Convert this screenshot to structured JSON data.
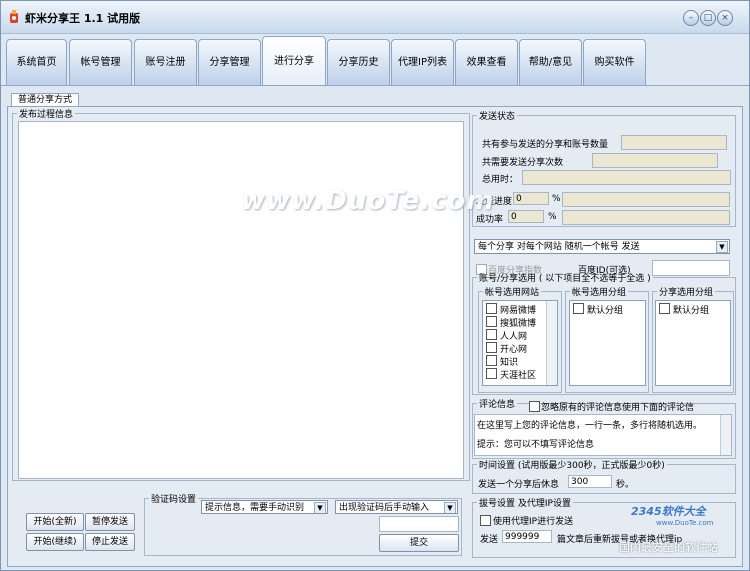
{
  "window": {
    "title": "虾米分享王 1.1 试用版"
  },
  "tabs": [
    {
      "label": "系统首页",
      "active": false
    },
    {
      "label": "帐号管理",
      "active": false
    },
    {
      "label": "账号注册",
      "active": false
    },
    {
      "label": "分享管理",
      "active": false
    },
    {
      "label": "进行分享",
      "active": true
    },
    {
      "label": "分享历史",
      "active": false
    },
    {
      "label": "代理IP列表",
      "active": false
    },
    {
      "label": "效果查看",
      "active": false
    },
    {
      "label": "帮助/意见",
      "active": false
    },
    {
      "label": "购买软件",
      "active": false
    }
  ],
  "subtab": {
    "label": "普通分享方式"
  },
  "log": {
    "legend": "发布过程信息"
  },
  "buttons": {
    "start_new": "开始(全新)",
    "pause": "暂停发送",
    "start_continue": "开始(继续)",
    "stop": "停止发送",
    "submit": "提交"
  },
  "captcha": {
    "legend": "验证码设置",
    "mode_value": "提示信息，需要手动识别",
    "when_value": "出现验证码后手动输入"
  },
  "status": {
    "legend": "发送状态",
    "total_accounts_label": "共有参与发送的分享和账号数量",
    "total_send_label": "共需要发送分享次数",
    "total_time_label": "总用时：",
    "progress_label": "发送进度",
    "progress_value": "0",
    "success_label": "成功率",
    "success_value": "0",
    "percent": "%"
  },
  "strategy": {
    "value": "每个分享 对每个网站 随机一个帐号 发送"
  },
  "baidu": {
    "index_label": "百度分享指数",
    "id_label": "百度ID(可选)"
  },
  "selection": {
    "legend": "账号/分享选用 ( 以下项目全不选等于全选 )",
    "site_legend": "帐号选用网站",
    "sites": [
      "网易微博",
      "搜狐微博",
      "人人网",
      "开心网",
      "知识",
      "天涯社区"
    ],
    "group_legend": "帐号选用分组",
    "groups": [
      "默认分组"
    ],
    "share_group_legend": "分享选用分组",
    "share_groups": [
      "默认分组"
    ]
  },
  "comment": {
    "legend": "评论信息",
    "ignore_label": "忽略原有的评论信息使用下面的评论信",
    "line1": "在这里写上您的评论信息，一行一条，多行将随机选用。",
    "line2": "提示：您可以不填写评论信息"
  },
  "time": {
    "legend": "时间设置 (试用版最少300秒，正式版最少0秒)",
    "label_before": "发送一个分享后休息",
    "value": "300",
    "unit": "秒。"
  },
  "proxy": {
    "legend": "拔号设置  及代理IP设置",
    "use_proxy_label": "使用代理IP进行发送",
    "send_label": "发送",
    "count_value": "999999",
    "after_label": "篇文章后重新拔号或者换代理ip"
  },
  "colors": {
    "accent": "#8ea6c8",
    "window_bg": "#dfe7f0",
    "readonly_bg": "#ece7d3"
  }
}
